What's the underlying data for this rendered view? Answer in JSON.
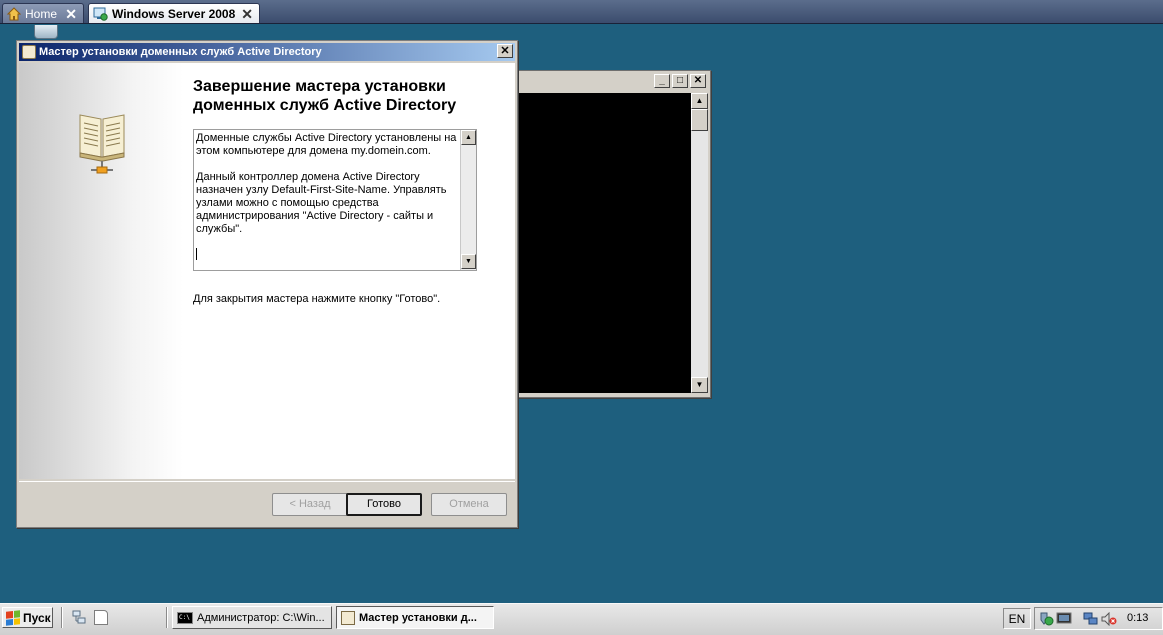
{
  "vm_tabs": [
    {
      "label": "Home",
      "close": "✕"
    },
    {
      "label": "Windows Server 2008",
      "close": "✕"
    }
  ],
  "console_window": {
    "buttons": {
      "minimize": "_",
      "maximize": "□",
      "close": "✕"
    },
    "scroll_up": "▲",
    "scroll_down": "▼"
  },
  "wizard": {
    "title": "Мастер установки доменных служб Active Directory",
    "close": "✕",
    "heading": "Завершение мастера установки доменных служб Active Directory",
    "info_text": "Доменные службы Active Directory установлены на этом компьютере для домена my.domein.com.\n\nДанный контроллер домена Active Directory назначен узлу Default-First-Site-Name. Управлять узлами можно с помощью средства администрирования \"Active Directory - сайты и службы\".",
    "scroll_up": "▲",
    "scroll_down": "▼",
    "close_hint": "Для закрытия мастера нажмите кнопку \"Готово\".",
    "buttons": {
      "back": "< Назад",
      "finish": "Готово",
      "cancel": "Отмена"
    }
  },
  "taskbar": {
    "start_label": "Пуск",
    "tasks": [
      {
        "label": "Администратор: C:\\Win...",
        "icon": "C:\\"
      },
      {
        "label": "Мастер установки д..."
      }
    ],
    "language": "EN",
    "clock": "0:13"
  },
  "colors": {
    "desktop": "#1e5f7e",
    "title_active_start": "#0a246a",
    "title_active_end": "#a6caf0"
  }
}
